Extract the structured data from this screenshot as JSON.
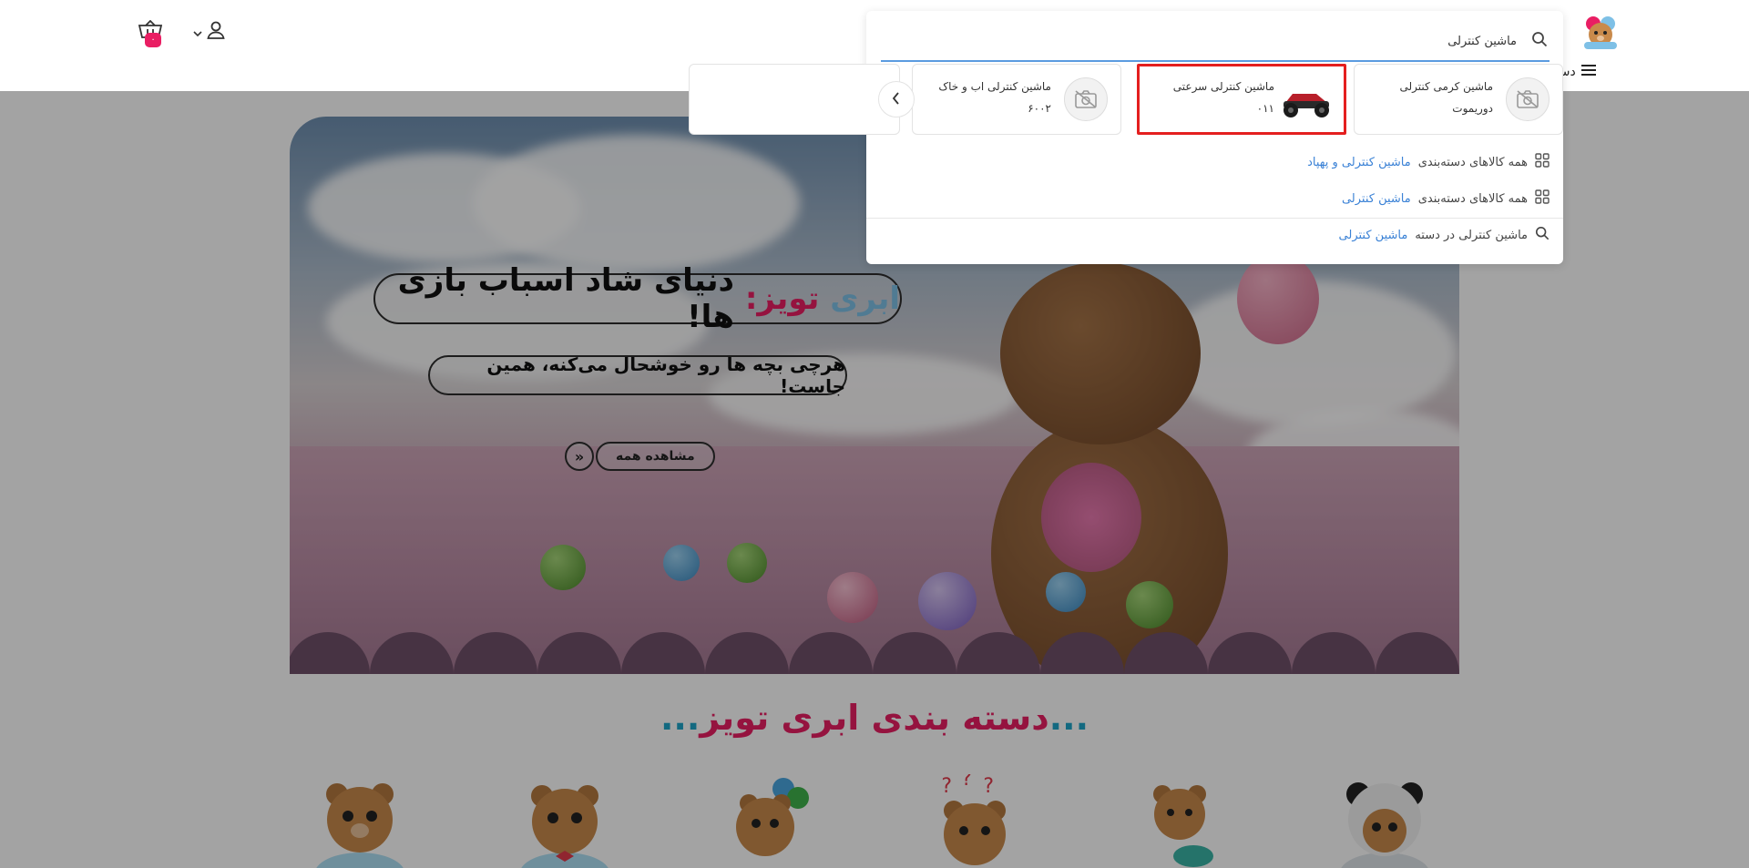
{
  "header": {
    "cart_count": "۰",
    "categories_label": "دسته"
  },
  "hero": {
    "title_brand_1": "ابری",
    "title_brand_2": "تویز:",
    "title_rest": "دنیای شاد اسباب بازی ها!",
    "subtitle": "هرچی بچه ها رو خوشحال می‌کنه، همین جاست!",
    "cta_label": "مشاهده همه"
  },
  "section": {
    "title_text": "دسته بندی ابری تویز",
    "title_dots": "..."
  },
  "search": {
    "query": "ماشین کنترلی",
    "products": [
      {
        "name": "ماشین کرمی کنترلی دوریموت",
        "has_image": false
      },
      {
        "name": "ماشین کنترلی سرعتی ۰۱۱",
        "has_image": true,
        "highlighted": true
      },
      {
        "name": "ماشین کنترلی اب و خاک ۶۰۰۲",
        "has_image": false
      }
    ],
    "suggestions": [
      {
        "prefix": "همه کالاهای دسته‌بندی",
        "link": "ماشین کنترلی و پهپاد",
        "icon": "grid-icon"
      },
      {
        "prefix": "همه کالاهای دسته‌بندی",
        "link": "ماشین کنترلی",
        "icon": "grid-icon"
      },
      {
        "prefix": "ماشین کنترلی در دسته",
        "link": "ماشین کنترلی",
        "icon": "search-icon"
      }
    ]
  },
  "colors": {
    "accent_pink": "#e91e63",
    "accent_blue": "#3b82d6",
    "highlight_red": "#e41f1f"
  }
}
